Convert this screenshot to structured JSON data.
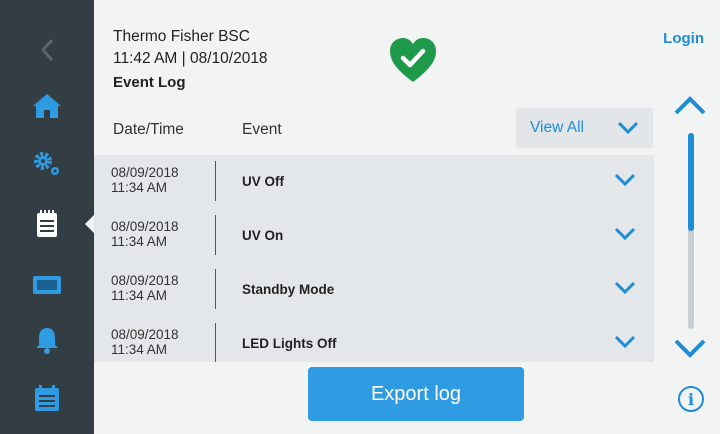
{
  "header": {
    "device_name": "Thermo Fisher BSC",
    "datetime": "11:42  AM | 08/10/2018",
    "page_title": "Event Log",
    "login_label": "Login",
    "status_icon": "heart-check-icon",
    "status_color": "#1f9a4a"
  },
  "sidebar": {
    "items": [
      {
        "name": "back",
        "icon": "chevron-left-icon"
      },
      {
        "name": "home",
        "icon": "home-icon"
      },
      {
        "name": "settings",
        "icon": "gears-icon"
      },
      {
        "name": "event-log",
        "icon": "notepad-icon",
        "active": true
      },
      {
        "name": "display",
        "icon": "screen-icon"
      },
      {
        "name": "alarms",
        "icon": "bell-icon"
      },
      {
        "name": "calendar",
        "icon": "calendar-icon"
      }
    ]
  },
  "table": {
    "col_datetime": "Date/Time",
    "col_event": "Event",
    "filter_label": "View All",
    "rows": [
      {
        "date": "08/09/2018",
        "time": "11:34  AM",
        "event": "UV Off"
      },
      {
        "date": "08/09/2018",
        "time": "11:34  AM",
        "event": "UV On"
      },
      {
        "date": "08/09/2018",
        "time": "11:34  AM",
        "event": "Standby Mode"
      },
      {
        "date": "08/09/2018",
        "time": "11:34  AM",
        "event": "LED Lights Off"
      }
    ]
  },
  "footer": {
    "export_label": "Export log",
    "info_glyph": "i"
  },
  "colors": {
    "accent": "#1f8dd6",
    "sidebar_bg": "#333d44",
    "button_bg": "#2f9be3"
  }
}
